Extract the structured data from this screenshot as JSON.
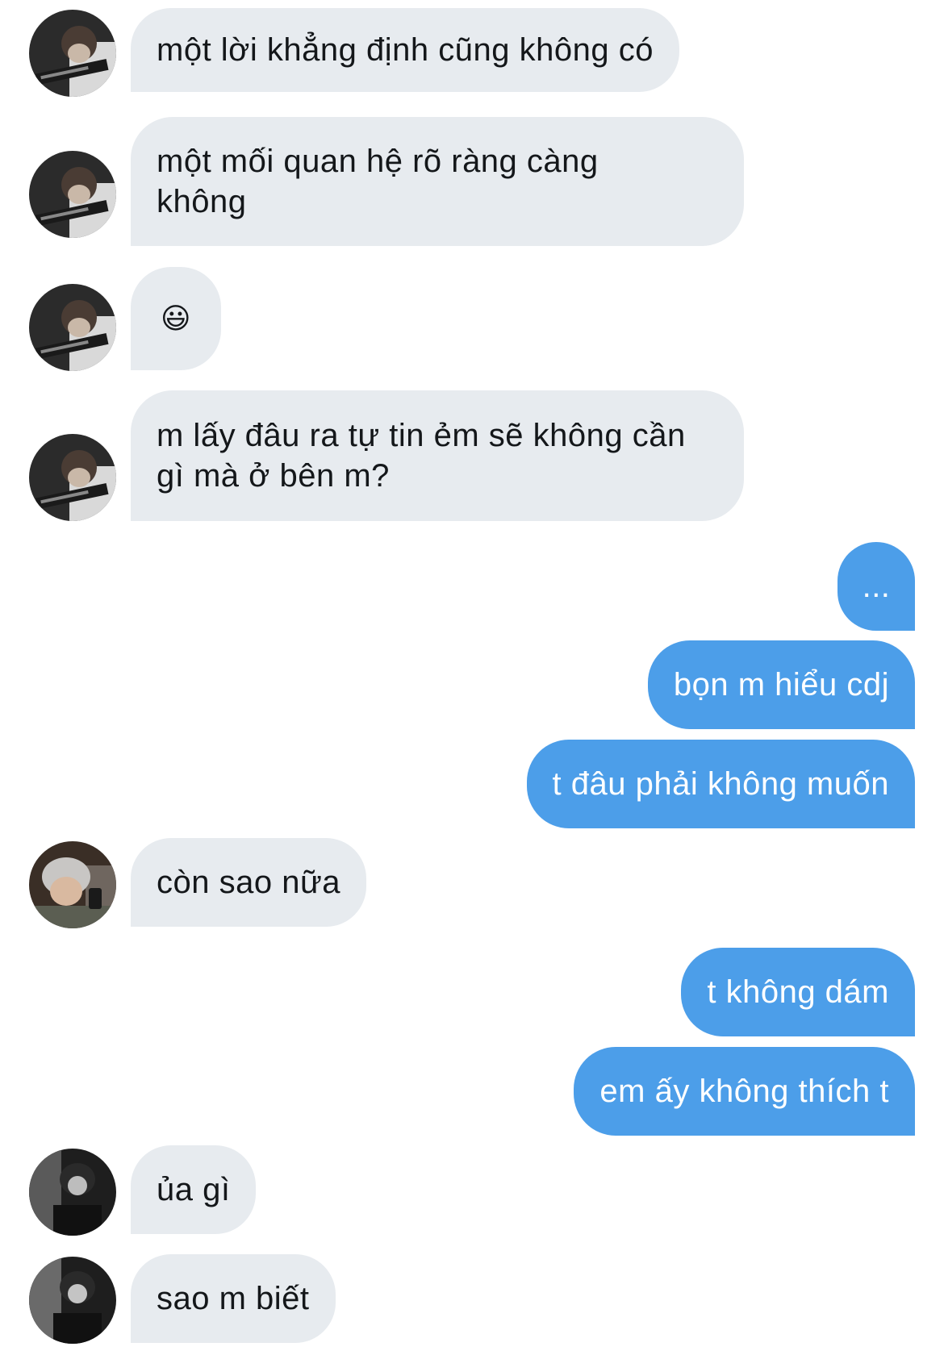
{
  "conversation": {
    "messages": [
      {
        "side": "in",
        "text": "một lời khẳng định cũng không có"
      },
      {
        "side": "in",
        "text": "một mối quan hệ rõ ràng càng không"
      },
      {
        "side": "in",
        "text": "😃"
      },
      {
        "side": "in",
        "text": "m lấy đâu ra tự tin ẻm sẽ không cần gì mà ở bên m?"
      },
      {
        "side": "out",
        "text": "..."
      },
      {
        "side": "out",
        "text": "bọn m hiểu cdj"
      },
      {
        "side": "out",
        "text": "t đâu phải không muốn"
      },
      {
        "side": "in",
        "text": "còn sao nữa"
      },
      {
        "side": "out",
        "text": "t không dám"
      },
      {
        "side": "out",
        "text": "em ấy không thích t"
      },
      {
        "side": "in",
        "text": "ủa gì"
      },
      {
        "side": "in",
        "text": "sao m biết"
      }
    ]
  },
  "colors": {
    "incoming_bubble": "#e7ebef",
    "outgoing_bubble": "#4c9ee9",
    "incoming_text": "#14171a",
    "outgoing_text": "#ffffff"
  }
}
